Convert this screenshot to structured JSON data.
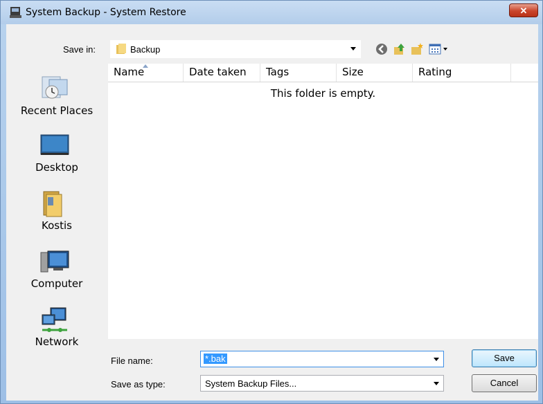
{
  "window": {
    "title": "System Backup - System Restore",
    "close_label": "✕"
  },
  "toolbar": {
    "save_in_label": "Save in:",
    "save_in_value": "Backup",
    "icons": [
      "back-icon",
      "up-folder-icon",
      "new-folder-icon",
      "views-icon"
    ]
  },
  "places": [
    {
      "label": "Recent Places",
      "icon": "recent-places-icon"
    },
    {
      "label": "Desktop",
      "icon": "desktop-icon"
    },
    {
      "label": "Kostis",
      "icon": "user-folder-icon"
    },
    {
      "label": "Computer",
      "icon": "computer-icon"
    },
    {
      "label": "Network",
      "icon": "network-icon"
    }
  ],
  "list": {
    "columns": [
      "Name",
      "Date taken",
      "Tags",
      "Size",
      "Rating"
    ],
    "empty_message": "This folder is empty."
  },
  "form": {
    "file_name_label": "File name:",
    "file_name_value": "*.bak",
    "save_as_type_label": "Save as type:",
    "save_as_type_value": "System Backup Files..."
  },
  "buttons": {
    "save": "Save",
    "cancel": "Cancel"
  },
  "colors": {
    "title_bar": "#b9d3ee",
    "close_button": "#c9452b",
    "selection": "#3399ff"
  }
}
